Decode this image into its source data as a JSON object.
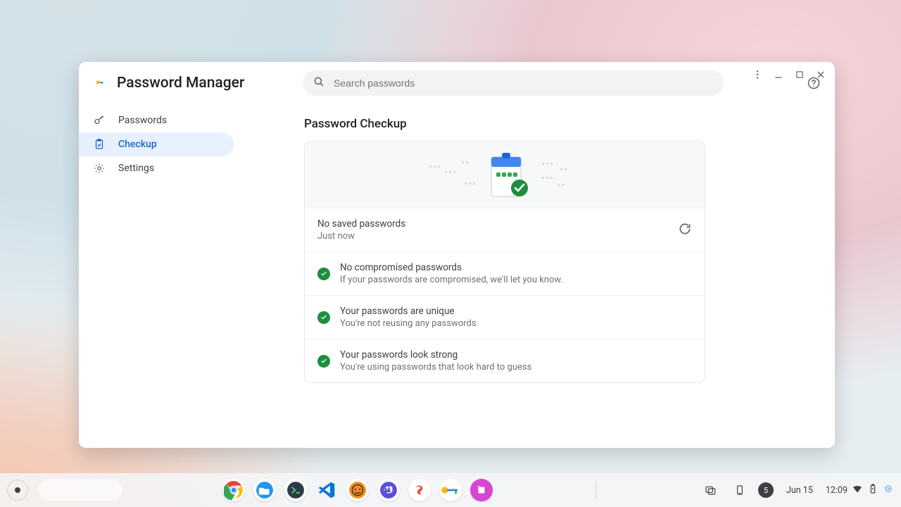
{
  "window": {
    "app_title": "Password Manager"
  },
  "search": {
    "placeholder": "Search passwords"
  },
  "sidebar": {
    "items": [
      {
        "id": "passwords",
        "label": "Passwords",
        "icon": "key-icon",
        "active": false
      },
      {
        "id": "checkup",
        "label": "Checkup",
        "icon": "clipboard-icon",
        "active": true
      },
      {
        "id": "settings",
        "label": "Settings",
        "icon": "gear-icon",
        "active": false
      }
    ]
  },
  "page": {
    "title": "Password Checkup",
    "status": {
      "title": "No saved passwords",
      "sub": "Just now"
    },
    "rows": [
      {
        "title": "No compromised passwords",
        "sub": "If your passwords are compromised, we'll let you know."
      },
      {
        "title": "Your passwords are unique",
        "sub": "You're not reusing any passwords"
      },
      {
        "title": "Your passwords look strong",
        "sub": "You're using passwords that look hard to guess"
      }
    ]
  },
  "shelf": {
    "date": "Jun 15",
    "time": "12:09",
    "notification_count": "5",
    "apps": [
      "chrome",
      "files",
      "terminal",
      "vscode",
      "lutris",
      "mastodon",
      "superlist",
      "password-manager",
      "screenshot"
    ]
  }
}
